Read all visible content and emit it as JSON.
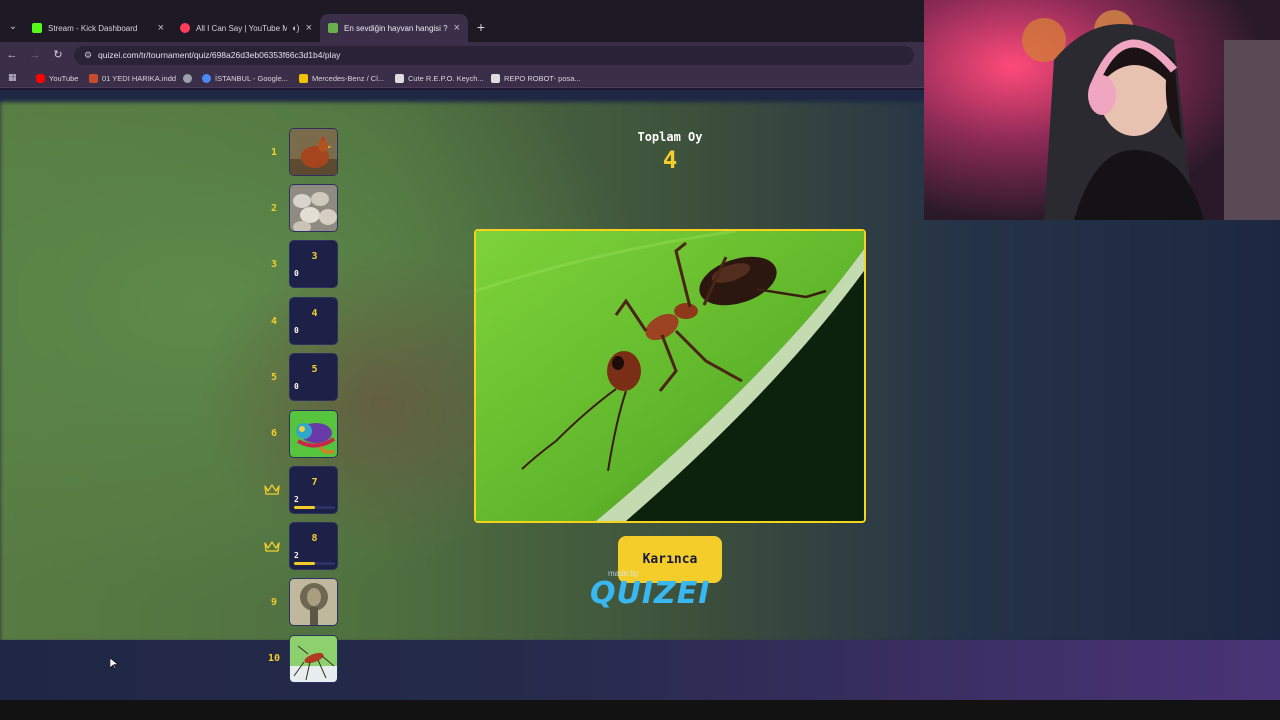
{
  "browser": {
    "tabs": [
      {
        "title": "Stream - Kick Dashboard",
        "favicon_color": "#53fc18",
        "active": false
      },
      {
        "title": "All I Can Say | YouTube Mu",
        "favicon_color": "#ff3d5a",
        "active": false
      },
      {
        "title": "En sevdiğin hayvan hangisi ? - ",
        "favicon_color": "#6ab04c",
        "active": true
      }
    ],
    "url": "quizei.com/tr/tournament/quiz/698a26d3eb06353f66c3d1b4/play",
    "bookmarks": [
      {
        "label": "YouTube",
        "icon_color": "#ff0000"
      },
      {
        "label": "01 YEDI HARIKA.indd",
        "icon_color": "#c94c2a"
      },
      {
        "label": "",
        "icon_color": "#9aa0aa"
      },
      {
        "label": "İSTANBUL - Google...",
        "icon_color": "#4a8af4"
      },
      {
        "label": "Mercedes-Benz / Cl...",
        "icon_color": "#f2c200"
      },
      {
        "label": "Cute R.E.P.O. Keych...",
        "icon_color": "#dddddd"
      },
      {
        "label": "REPO ROBOT- posa...",
        "icon_color": "#dddddd"
      }
    ]
  },
  "quiz": {
    "total_label": "Toplam Oy",
    "total_value": "4",
    "answer_label": "Karınca",
    "brand_small": "made by",
    "brand": "QUIZEI",
    "accent_color": "#f5cd2b",
    "entries": [
      {
        "rank": "1",
        "kind": "image",
        "icon": "chicken-thumbnail"
      },
      {
        "rank": "2",
        "kind": "image",
        "icon": "sheep-thumbnail"
      },
      {
        "rank": "3",
        "kind": "card",
        "votes": "0",
        "share": 0
      },
      {
        "rank": "4",
        "kind": "card",
        "votes": "0",
        "share": 0
      },
      {
        "rank": "5",
        "kind": "card",
        "votes": "0",
        "share": 0
      },
      {
        "rank": "6",
        "kind": "image",
        "icon": "chameleon-thumbnail"
      },
      {
        "rank": "7",
        "kind": "card",
        "votes": "2",
        "share": 0.5,
        "crown": true
      },
      {
        "rank": "8",
        "kind": "card",
        "votes": "2",
        "share": 0.5,
        "crown": true
      },
      {
        "rank": "9",
        "kind": "image",
        "icon": "cobra-thumbnail"
      },
      {
        "rank": "10",
        "kind": "image",
        "icon": "mosquito-thumbnail"
      }
    ]
  }
}
